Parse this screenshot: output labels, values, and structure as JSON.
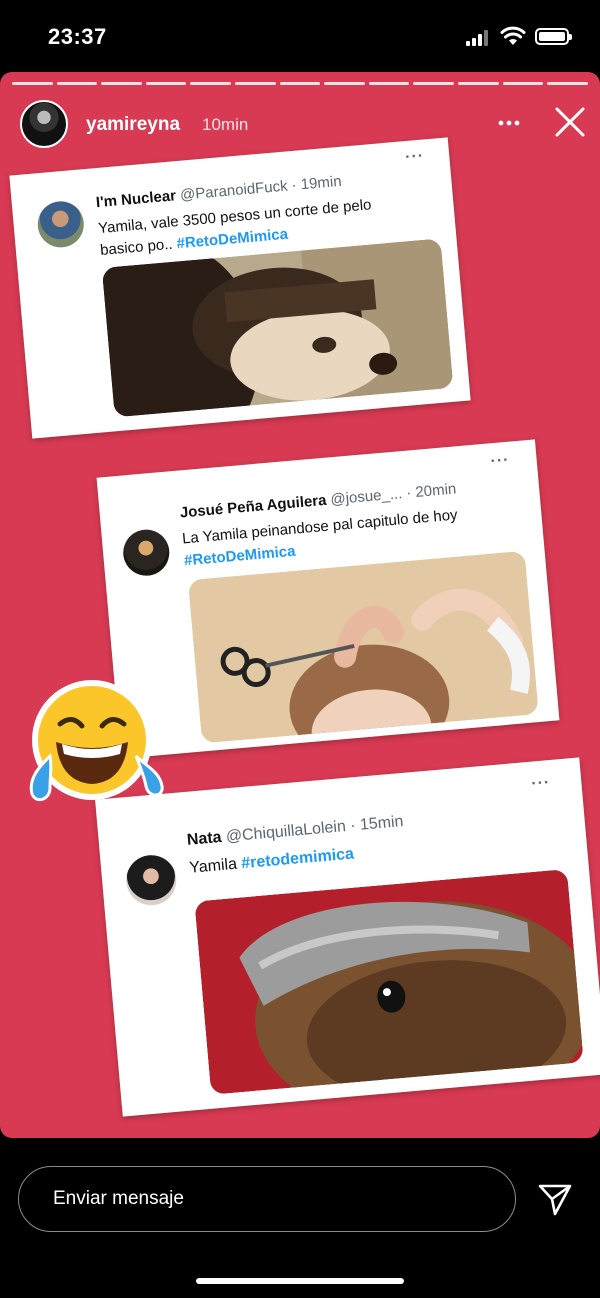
{
  "status": {
    "time": "23:37"
  },
  "story": {
    "username": "yamireyna",
    "time_ago": "10min",
    "more_icon": "more-dots-icon",
    "close_icon": "close-icon"
  },
  "tweets": [
    {
      "name": "I'm Nuclear",
      "handle": "@ParanoidFuck · 19min",
      "text_line1": "Yamila, vale 3500 pesos un corte de pelo",
      "text_line2": "basico po..",
      "hashtag": "#RetoDeMimica",
      "dots": "···"
    },
    {
      "name": "Josué Peña Aguilera",
      "handle": "@josue_... · 20min",
      "text_line1": "La Yamila peinandose pal capitulo de hoy",
      "hashtag": "#RetoDeMimica",
      "dots": "···"
    },
    {
      "name": "Nata",
      "handle": "@ChiquillaLolein · 15min",
      "text_line1": "Yamila",
      "hashtag": "#retodemimica",
      "dots": "···"
    }
  ],
  "sticker": {
    "icon": "laughing-tears-emoji-icon"
  },
  "composer": {
    "placeholder": "Enviar mensaje",
    "send_icon": "send-icon"
  },
  "colors": {
    "story_bg": "#d73a52",
    "hashtag": "#1d9bf0"
  }
}
